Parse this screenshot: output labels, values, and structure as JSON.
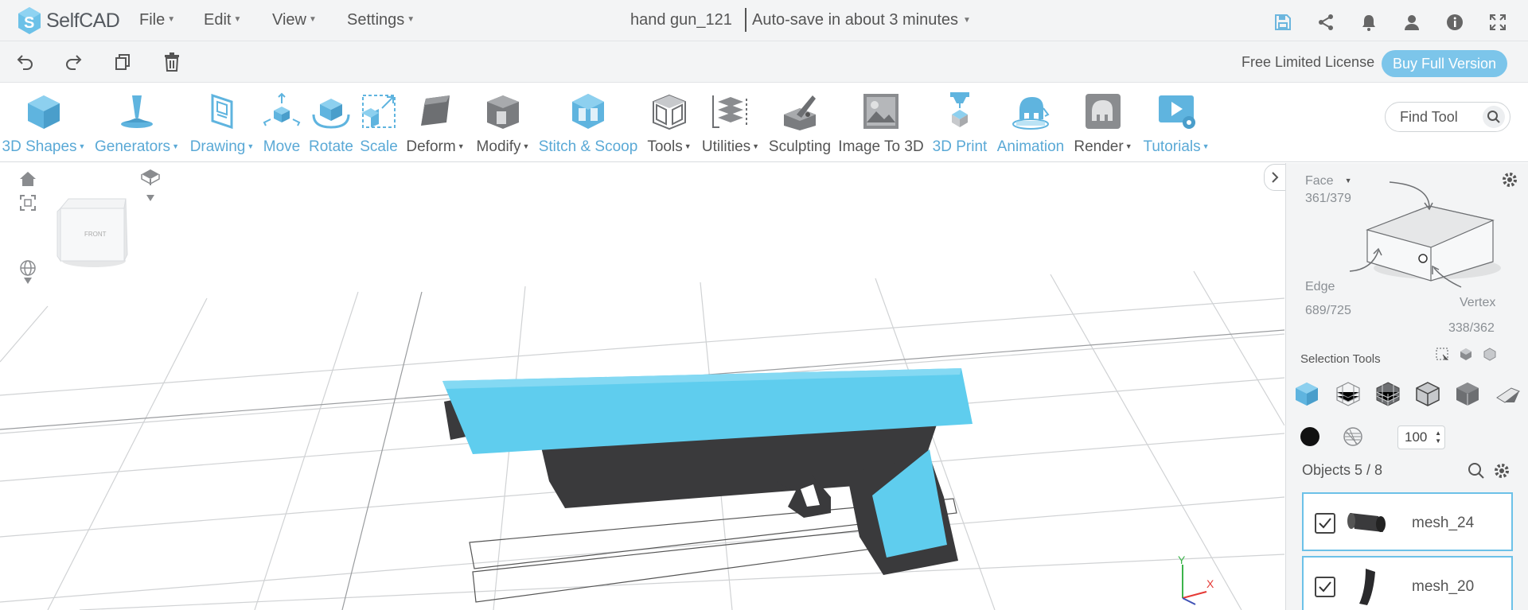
{
  "app": {
    "logo_text": "SelfCAD"
  },
  "menu": {
    "file": "File",
    "edit": "Edit",
    "view": "View",
    "settings": "Settings"
  },
  "project": {
    "title": "hand gun_121",
    "autosave": "Auto-save in about 3 minutes"
  },
  "license": {
    "text": "Free Limited License",
    "buy_label": "Buy Full Version"
  },
  "ribbon": {
    "tools": [
      {
        "label": "3D Shapes",
        "dropdown": true
      },
      {
        "label": "Generators",
        "dropdown": true
      },
      {
        "label": "Drawing",
        "dropdown": true
      },
      {
        "label": "Move"
      },
      {
        "label": "Rotate"
      },
      {
        "label": "Scale"
      },
      {
        "label": "Deform",
        "dropdown": true
      },
      {
        "label": "Modify",
        "dropdown": true
      },
      {
        "label": "Stitch & Scoop"
      },
      {
        "label": "Tools",
        "dropdown": true
      },
      {
        "label": "Utilities",
        "dropdown": true
      },
      {
        "label": "Sculpting"
      },
      {
        "label": "Image To 3D"
      },
      {
        "label": "3D Print"
      },
      {
        "label": "Animation"
      },
      {
        "label": "Render",
        "dropdown": true
      },
      {
        "label": "Tutorials",
        "dropdown": true
      }
    ],
    "find_placeholder": "Find Tool"
  },
  "viewcube": {
    "front_label": "FRONT"
  },
  "axes": {
    "y": "Y",
    "x": "X"
  },
  "selection": {
    "face_label": "Face",
    "face_count": "361/379",
    "edge_label": "Edge",
    "edge_count": "689/725",
    "vertex_label": "Vertex",
    "vertex_count": "338/362",
    "tools_label": "Selection Tools",
    "opacity_value": "100"
  },
  "objects": {
    "title": "Objects 5 / 8",
    "items": [
      {
        "name": "mesh_24"
      },
      {
        "name": "mesh_20"
      }
    ]
  },
  "colors": {
    "accent": "#5aa9d6",
    "model_blue": "#5fcdee",
    "model_dark": "#3a3a3c",
    "buy_button": "#7cc5ea"
  }
}
